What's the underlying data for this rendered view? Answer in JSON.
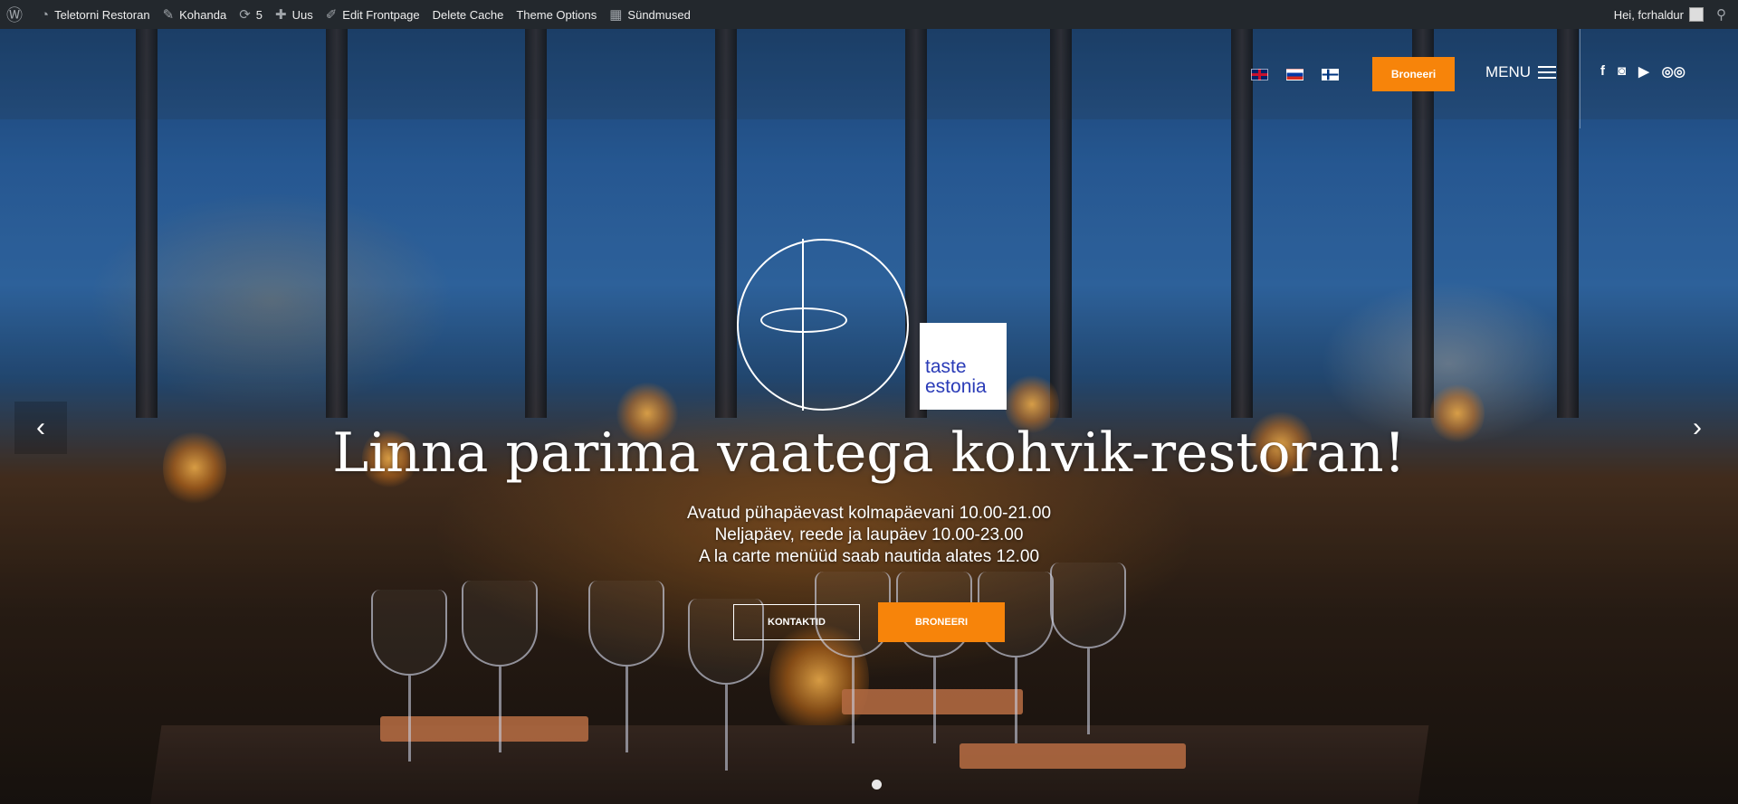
{
  "adminbar": {
    "items": [
      {
        "icon": "wordpress-icon",
        "label": ""
      },
      {
        "icon": "dashboard-icon",
        "label": "Teletorni Restoran"
      },
      {
        "icon": "brush-icon",
        "label": "Kohanda"
      },
      {
        "icon": "update-icon",
        "label": "5"
      },
      {
        "icon": "plus-icon",
        "label": "Uus"
      },
      {
        "icon": "pencil-icon",
        "label": "Edit Frontpage"
      },
      {
        "icon": "",
        "label": "Delete Cache"
      },
      {
        "icon": "",
        "label": "Theme Options"
      },
      {
        "icon": "calendar-icon",
        "label": "Sündmused"
      }
    ],
    "greeting": "Hei, fcrhaldur"
  },
  "header": {
    "languages": [
      "English",
      "Russian",
      "Finnish"
    ],
    "book_button": "Broneeri",
    "menu_label": "MENU",
    "social": [
      "facebook-icon",
      "instagram-icon",
      "youtube-icon",
      "tripadvisor-icon"
    ]
  },
  "logos": {
    "partner_line1": "taste",
    "partner_line2": "estonia"
  },
  "slide": {
    "headline": "Linna parima vaatega kohvik-restoran!",
    "hours": [
      "Avatud pühapäevast kolmapäevani 10.00-21.00",
      "Neljapäev, reede ja laupäev 10.00-23.00",
      "A la carte menüüd saab nautida alates 12.00"
    ],
    "contact_button": "KONTAKTID",
    "book_button": "BRONEERI"
  },
  "colors": {
    "accent": "#f7840a",
    "adminbar": "#23282d",
    "partner_text": "#2a3bb7"
  }
}
